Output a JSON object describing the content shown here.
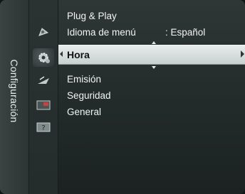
{
  "sidebar": {
    "title": "Configuración"
  },
  "icons": [
    "input-icon",
    "setup-gear-icon",
    "channel-satellite-icon",
    "picture-in-picture-icon",
    "help-icon"
  ],
  "menu": {
    "items": [
      {
        "label": "Plug & Play",
        "value": ""
      },
      {
        "label": "Idioma de menú",
        "value": ": Español"
      },
      {
        "label": "Hora",
        "value": "",
        "selected": true
      },
      {
        "label": "Emisión",
        "value": ""
      },
      {
        "label": "Seguridad",
        "value": ""
      },
      {
        "label": "General",
        "value": ""
      }
    ]
  },
  "colors": {
    "highlight": "#d9dfdf",
    "text": "#f2f4f4",
    "background": "#2b3232"
  }
}
